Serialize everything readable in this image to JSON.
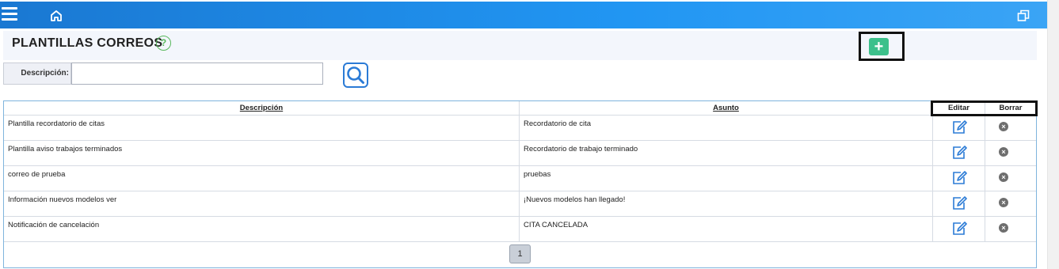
{
  "header": {
    "menu_icon": "hamburger-icon",
    "home_icon": "home-icon",
    "window_icon": "restore-window-icon"
  },
  "page": {
    "title": "PLANTILLAS CORREOS",
    "help_label": "?",
    "add_label": "+"
  },
  "filter": {
    "label": "Descripción:",
    "value": "",
    "placeholder": ""
  },
  "table": {
    "columns": [
      "Descripción",
      "Asunto",
      "Editar",
      "Borrar"
    ],
    "rows": [
      {
        "descripcion": "Plantilla recordatorio de citas",
        "asunto": "Recordatorio de cita"
      },
      {
        "descripcion": "Plantilla aviso trabajos terminados",
        "asunto": "Recordatorio de trabajo terminado"
      },
      {
        "descripcion": "correo de prueba",
        "asunto": "pruebas"
      },
      {
        "descripcion": "Información nuevos modelos ver",
        "asunto": "¡Nuevos modelos han llegado!"
      },
      {
        "descripcion": "Notificación de cancelación",
        "asunto": "CITA CANCELADA"
      }
    ],
    "delete_glyph": "×"
  },
  "pagination": {
    "current_page": "1"
  },
  "colors": {
    "topbar": "#2196f3",
    "add_button": "#3cc08b",
    "help": "#58b85c",
    "edit_icon": "#2b7bd6"
  }
}
